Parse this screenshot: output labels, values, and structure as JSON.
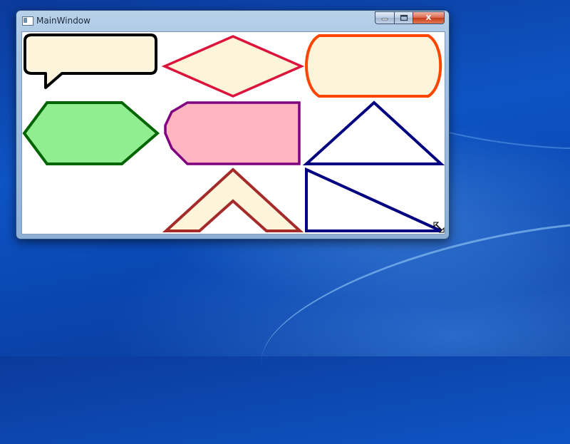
{
  "window": {
    "title": "MainWindow"
  },
  "caption_buttons": {
    "minimize_icon": "minimize-icon",
    "maximize_icon": "maximize-icon",
    "close_icon": "close-icon",
    "close_glyph": "X"
  },
  "shapes": [
    {
      "kind": "callout",
      "fill": "#FDF4DC",
      "stroke": "#000000"
    },
    {
      "kind": "diamond",
      "fill": "#FDF4DC",
      "stroke": "#DC143C"
    },
    {
      "kind": "pill",
      "fill": "#FDF4DC",
      "stroke": "#FF4500"
    },
    {
      "kind": "hexagon",
      "fill": "#90EE90",
      "stroke": "#006400"
    },
    {
      "kind": "tag",
      "fill": "#FFB6C1",
      "stroke": "#800080"
    },
    {
      "kind": "triangle",
      "fill": "#FFFFFF",
      "stroke": "#000080"
    },
    {
      "kind": "chevron",
      "fill": "#FDF4DC",
      "stroke": "#A52A2A"
    },
    {
      "kind": "right-triangle",
      "fill": "#FFFFFF",
      "stroke": "#000080"
    }
  ],
  "colors": {
    "title_text": "#1E2B3A",
    "client_background": "#FFFFFF"
  }
}
